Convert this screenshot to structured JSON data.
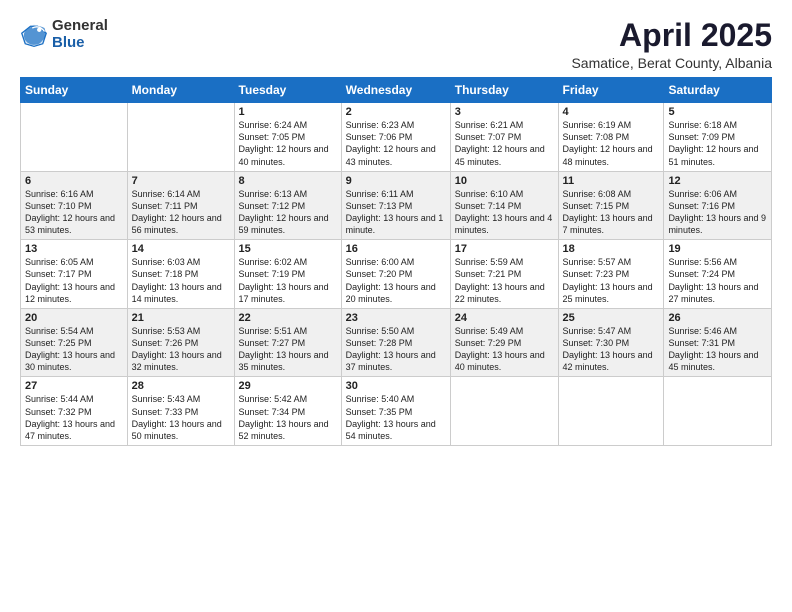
{
  "logo": {
    "general": "General",
    "blue": "Blue"
  },
  "title": "April 2025",
  "subtitle": "Samatice, Berat County, Albania",
  "days": [
    "Sunday",
    "Monday",
    "Tuesday",
    "Wednesday",
    "Thursday",
    "Friday",
    "Saturday"
  ],
  "weeks": [
    [
      {
        "num": "",
        "sunrise": "",
        "sunset": "",
        "daylight": ""
      },
      {
        "num": "",
        "sunrise": "",
        "sunset": "",
        "daylight": ""
      },
      {
        "num": "1",
        "sunrise": "Sunrise: 6:24 AM",
        "sunset": "Sunset: 7:05 PM",
        "daylight": "Daylight: 12 hours and 40 minutes."
      },
      {
        "num": "2",
        "sunrise": "Sunrise: 6:23 AM",
        "sunset": "Sunset: 7:06 PM",
        "daylight": "Daylight: 12 hours and 43 minutes."
      },
      {
        "num": "3",
        "sunrise": "Sunrise: 6:21 AM",
        "sunset": "Sunset: 7:07 PM",
        "daylight": "Daylight: 12 hours and 45 minutes."
      },
      {
        "num": "4",
        "sunrise": "Sunrise: 6:19 AM",
        "sunset": "Sunset: 7:08 PM",
        "daylight": "Daylight: 12 hours and 48 minutes."
      },
      {
        "num": "5",
        "sunrise": "Sunrise: 6:18 AM",
        "sunset": "Sunset: 7:09 PM",
        "daylight": "Daylight: 12 hours and 51 minutes."
      }
    ],
    [
      {
        "num": "6",
        "sunrise": "Sunrise: 6:16 AM",
        "sunset": "Sunset: 7:10 PM",
        "daylight": "Daylight: 12 hours and 53 minutes."
      },
      {
        "num": "7",
        "sunrise": "Sunrise: 6:14 AM",
        "sunset": "Sunset: 7:11 PM",
        "daylight": "Daylight: 12 hours and 56 minutes."
      },
      {
        "num": "8",
        "sunrise": "Sunrise: 6:13 AM",
        "sunset": "Sunset: 7:12 PM",
        "daylight": "Daylight: 12 hours and 59 minutes."
      },
      {
        "num": "9",
        "sunrise": "Sunrise: 6:11 AM",
        "sunset": "Sunset: 7:13 PM",
        "daylight": "Daylight: 13 hours and 1 minute."
      },
      {
        "num": "10",
        "sunrise": "Sunrise: 6:10 AM",
        "sunset": "Sunset: 7:14 PM",
        "daylight": "Daylight: 13 hours and 4 minutes."
      },
      {
        "num": "11",
        "sunrise": "Sunrise: 6:08 AM",
        "sunset": "Sunset: 7:15 PM",
        "daylight": "Daylight: 13 hours and 7 minutes."
      },
      {
        "num": "12",
        "sunrise": "Sunrise: 6:06 AM",
        "sunset": "Sunset: 7:16 PM",
        "daylight": "Daylight: 13 hours and 9 minutes."
      }
    ],
    [
      {
        "num": "13",
        "sunrise": "Sunrise: 6:05 AM",
        "sunset": "Sunset: 7:17 PM",
        "daylight": "Daylight: 13 hours and 12 minutes."
      },
      {
        "num": "14",
        "sunrise": "Sunrise: 6:03 AM",
        "sunset": "Sunset: 7:18 PM",
        "daylight": "Daylight: 13 hours and 14 minutes."
      },
      {
        "num": "15",
        "sunrise": "Sunrise: 6:02 AM",
        "sunset": "Sunset: 7:19 PM",
        "daylight": "Daylight: 13 hours and 17 minutes."
      },
      {
        "num": "16",
        "sunrise": "Sunrise: 6:00 AM",
        "sunset": "Sunset: 7:20 PM",
        "daylight": "Daylight: 13 hours and 20 minutes."
      },
      {
        "num": "17",
        "sunrise": "Sunrise: 5:59 AM",
        "sunset": "Sunset: 7:21 PM",
        "daylight": "Daylight: 13 hours and 22 minutes."
      },
      {
        "num": "18",
        "sunrise": "Sunrise: 5:57 AM",
        "sunset": "Sunset: 7:23 PM",
        "daylight": "Daylight: 13 hours and 25 minutes."
      },
      {
        "num": "19",
        "sunrise": "Sunrise: 5:56 AM",
        "sunset": "Sunset: 7:24 PM",
        "daylight": "Daylight: 13 hours and 27 minutes."
      }
    ],
    [
      {
        "num": "20",
        "sunrise": "Sunrise: 5:54 AM",
        "sunset": "Sunset: 7:25 PM",
        "daylight": "Daylight: 13 hours and 30 minutes."
      },
      {
        "num": "21",
        "sunrise": "Sunrise: 5:53 AM",
        "sunset": "Sunset: 7:26 PM",
        "daylight": "Daylight: 13 hours and 32 minutes."
      },
      {
        "num": "22",
        "sunrise": "Sunrise: 5:51 AM",
        "sunset": "Sunset: 7:27 PM",
        "daylight": "Daylight: 13 hours and 35 minutes."
      },
      {
        "num": "23",
        "sunrise": "Sunrise: 5:50 AM",
        "sunset": "Sunset: 7:28 PM",
        "daylight": "Daylight: 13 hours and 37 minutes."
      },
      {
        "num": "24",
        "sunrise": "Sunrise: 5:49 AM",
        "sunset": "Sunset: 7:29 PM",
        "daylight": "Daylight: 13 hours and 40 minutes."
      },
      {
        "num": "25",
        "sunrise": "Sunrise: 5:47 AM",
        "sunset": "Sunset: 7:30 PM",
        "daylight": "Daylight: 13 hours and 42 minutes."
      },
      {
        "num": "26",
        "sunrise": "Sunrise: 5:46 AM",
        "sunset": "Sunset: 7:31 PM",
        "daylight": "Daylight: 13 hours and 45 minutes."
      }
    ],
    [
      {
        "num": "27",
        "sunrise": "Sunrise: 5:44 AM",
        "sunset": "Sunset: 7:32 PM",
        "daylight": "Daylight: 13 hours and 47 minutes."
      },
      {
        "num": "28",
        "sunrise": "Sunrise: 5:43 AM",
        "sunset": "Sunset: 7:33 PM",
        "daylight": "Daylight: 13 hours and 50 minutes."
      },
      {
        "num": "29",
        "sunrise": "Sunrise: 5:42 AM",
        "sunset": "Sunset: 7:34 PM",
        "daylight": "Daylight: 13 hours and 52 minutes."
      },
      {
        "num": "30",
        "sunrise": "Sunrise: 5:40 AM",
        "sunset": "Sunset: 7:35 PM",
        "daylight": "Daylight: 13 hours and 54 minutes."
      },
      {
        "num": "",
        "sunrise": "",
        "sunset": "",
        "daylight": ""
      },
      {
        "num": "",
        "sunrise": "",
        "sunset": "",
        "daylight": ""
      },
      {
        "num": "",
        "sunrise": "",
        "sunset": "",
        "daylight": ""
      }
    ]
  ]
}
